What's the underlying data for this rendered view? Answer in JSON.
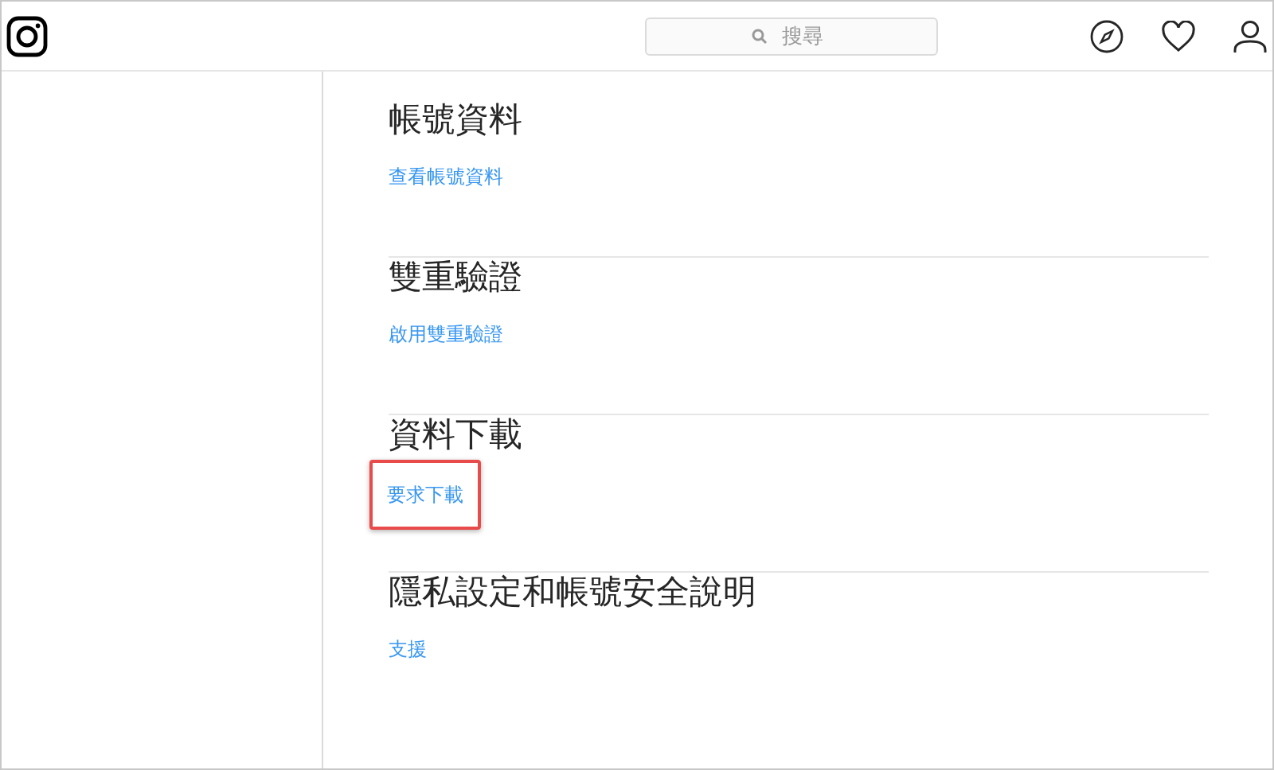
{
  "header": {
    "search": {
      "placeholder": "搜尋"
    }
  },
  "sections": [
    {
      "title": "帳號資料",
      "link": "查看帳號資料",
      "highlighted": false
    },
    {
      "title": "雙重驗證",
      "link": "啟用雙重驗證",
      "highlighted": false
    },
    {
      "title": "資料下載",
      "link": "要求下載",
      "highlighted": true
    },
    {
      "title": "隱私設定和帳號安全說明",
      "link": "支援",
      "highlighted": false
    }
  ]
}
